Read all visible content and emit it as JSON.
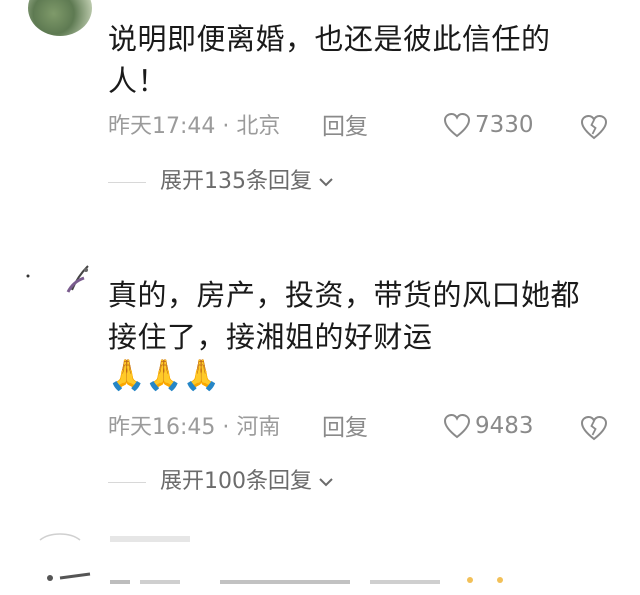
{
  "comments": [
    {
      "text": "说明即便离婚，也还是彼此信任的人！",
      "time": "昨天17:44",
      "location": "北京",
      "reply_label": "回复",
      "likes": "7330",
      "expand_label": "展开135条回复"
    },
    {
      "text": "真的，房产，投资，带货的风口她都接住了，接湘姐的好财运",
      "emojis": "🙏🙏🙏",
      "time": "昨天16:45",
      "location": "河南",
      "reply_label": "回复",
      "likes": "9483",
      "expand_label": "展开100条回复"
    }
  ],
  "colors": {
    "text": "#1a1a1a",
    "meta": "#9b9b9b",
    "icon": "#8a8a8a"
  },
  "icons": [
    "heart-outline-icon",
    "broken-heart-icon",
    "chevron-down-icon",
    "pray-emoji"
  ]
}
